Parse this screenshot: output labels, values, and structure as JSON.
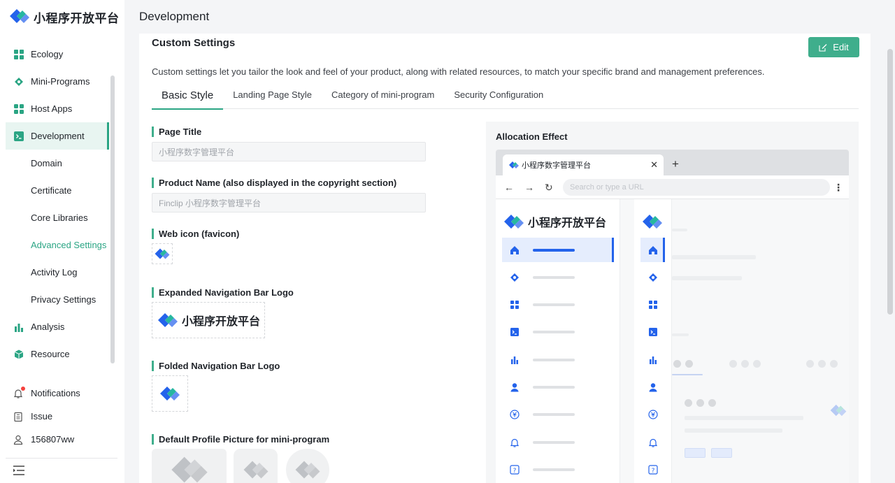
{
  "brand": {
    "name": "小程序开放平台"
  },
  "colors": {
    "accent": "#2ba584",
    "edit_button": "#3fae8c",
    "preview_accent": "#2463eb"
  },
  "sidebar": {
    "items": [
      {
        "label": "Ecology",
        "icon": "grid-icon"
      },
      {
        "label": "Mini-Programs",
        "icon": "diamond-icon"
      },
      {
        "label": "Host Apps",
        "icon": "apps-icon"
      },
      {
        "label": "Development",
        "icon": "terminal-icon",
        "active": true
      },
      {
        "label": "Domain"
      },
      {
        "label": "Certificate"
      },
      {
        "label": "Core Libraries"
      },
      {
        "label": "Advanced Settings",
        "active": true
      },
      {
        "label": "Activity Log"
      },
      {
        "label": "Privacy Settings"
      },
      {
        "label": "Analysis",
        "icon": "bar-chart-icon"
      },
      {
        "label": "Resource",
        "icon": "cube-icon"
      }
    ],
    "footer": [
      {
        "label": "Notifications",
        "icon": "bell-icon"
      },
      {
        "label": "Issue",
        "icon": "clipboard-icon"
      },
      {
        "label": "156807ww",
        "icon": "user-icon"
      }
    ]
  },
  "header": {
    "title": "Development"
  },
  "card": {
    "title": "Custom Settings",
    "edit_label": "Edit",
    "description": "Custom settings let you tailor the look and feel of your product, along with related resources, to match your specific brand and management preferences.",
    "tabs": [
      "Basic Style",
      "Landing Page Style",
      "Category of mini-program",
      "Security Configuration"
    ],
    "active_tab": "Basic Style"
  },
  "form": {
    "page_title": {
      "label": "Page Title",
      "placeholder": "小程序数字管理平台"
    },
    "product_name": {
      "label": "Product Name (also displayed in the copyright section)",
      "placeholder": "Finclip 小程序数字管理平台"
    },
    "web_icon": {
      "label": "Web icon (favicon)"
    },
    "expanded_logo": {
      "label": "Expanded Navigation Bar Logo",
      "logo_text": "小程序开放平台"
    },
    "folded_logo": {
      "label": "Folded Navigation Bar Logo"
    },
    "default_avatar": {
      "label": "Default Profile Picture for mini-program"
    }
  },
  "preview": {
    "title": "Allocation Effect",
    "tab_title": "小程序数字管理平台",
    "url_placeholder": "Search or type a URL",
    "logo_text": "小程序开放平台",
    "menu_icons": [
      "home-icon",
      "diamond-icon",
      "apps-icon",
      "terminal-icon",
      "bar-chart-icon",
      "user-icon",
      "coin-icon",
      "bell-icon",
      "help-icon"
    ]
  }
}
